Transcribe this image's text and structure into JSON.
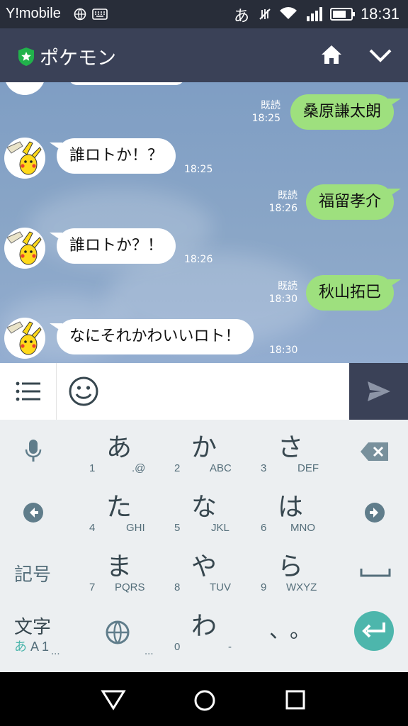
{
  "status_bar": {
    "carrier": "Y!mobile",
    "input_indicator": "あ",
    "time": "18:31"
  },
  "header": {
    "title": "ポケモン"
  },
  "messages": [
    {
      "dir": "out",
      "text": "桑原謙太朗",
      "read": "既読",
      "time": "18:25"
    },
    {
      "dir": "in",
      "text": "誰ロトか！？",
      "time": "18:25"
    },
    {
      "dir": "out",
      "text": "福留孝介",
      "read": "既読",
      "time": "18:26"
    },
    {
      "dir": "in",
      "text": "誰ロトか？！",
      "time": "18:26"
    },
    {
      "dir": "out",
      "text": "秋山拓巳",
      "read": "既読",
      "time": "18:30"
    },
    {
      "dir": "in",
      "text": "なにそれかわいいロト！",
      "time": "18:30"
    }
  ],
  "keyboard": {
    "row1": [
      {
        "kana": "あ",
        "num": "1",
        "lat": ".@"
      },
      {
        "kana": "か",
        "num": "2",
        "lat": "ABC"
      },
      {
        "kana": "さ",
        "num": "3",
        "lat": "DEF"
      }
    ],
    "row2": [
      {
        "kana": "た",
        "num": "4",
        "lat": "GHI"
      },
      {
        "kana": "な",
        "num": "5",
        "lat": "JKL"
      },
      {
        "kana": "は",
        "num": "6",
        "lat": "MNO"
      }
    ],
    "row3": [
      {
        "kana": "ま",
        "num": "7",
        "lat": "PQRS"
      },
      {
        "kana": "や",
        "num": "8",
        "lat": "TUV"
      },
      {
        "kana": "ら",
        "num": "9",
        "lat": "WXYZ"
      }
    ],
    "row4": {
      "wa": "わ",
      "zero": "0",
      "dash": "-",
      "punct": "、。",
      "ellipsis": "..."
    },
    "kigou": "記号",
    "moji": "文字",
    "mode": "あA1"
  },
  "colors": {
    "header": "#3a4157",
    "outgoing_bubble": "#9ee07e",
    "incoming_bubble": "#ffffff",
    "enter_key": "#4db6ac"
  }
}
